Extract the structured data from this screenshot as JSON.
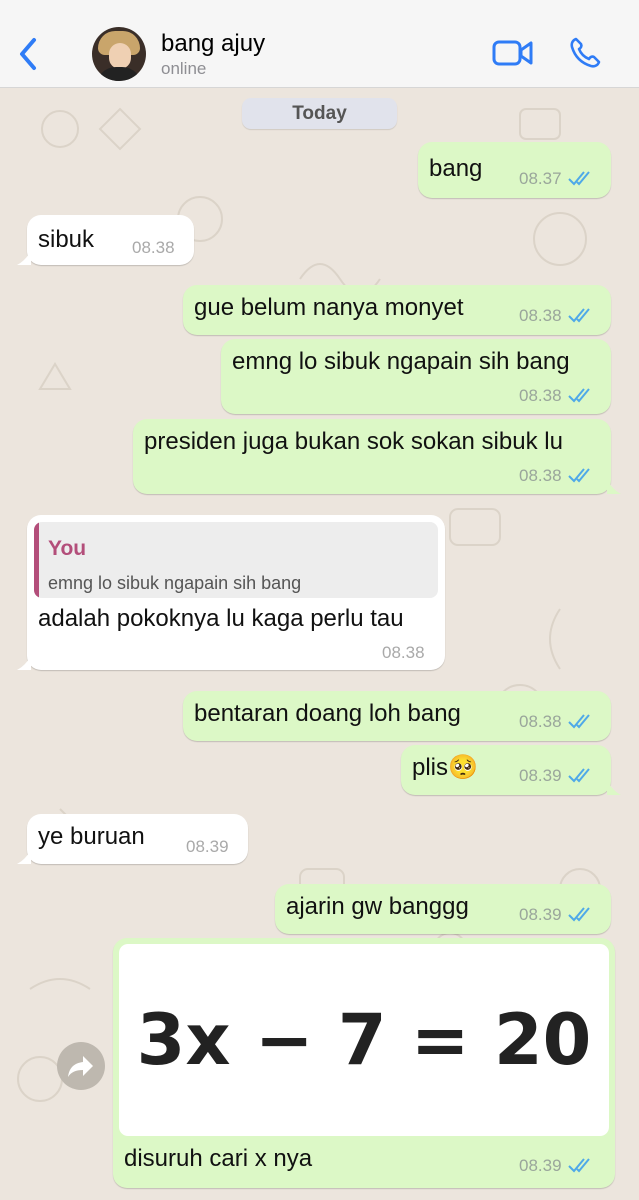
{
  "header": {
    "contact_name": "bang ajuy",
    "status": "online"
  },
  "date_chip": "Today",
  "messages": [
    {
      "dir": "out",
      "text": "bang",
      "time": "08.37",
      "read": true
    },
    {
      "dir": "in",
      "text": "sibuk",
      "time": "08.38"
    },
    {
      "dir": "out",
      "text": "gue belum nanya monyet",
      "time": "08.38",
      "read": true
    },
    {
      "dir": "out",
      "text": "emng lo sibuk ngapain sih bang",
      "time": "08.38",
      "read": true
    },
    {
      "dir": "out",
      "text": "presiden juga bukan sok sokan sibuk lu",
      "time": "08.38",
      "read": true
    },
    {
      "dir": "in",
      "quote_author": "You",
      "quote_text": "emng lo sibuk ngapain sih bang",
      "text": "adalah pokoknya lu kaga perlu tau",
      "time": "08.38"
    },
    {
      "dir": "out",
      "text": "bentaran doang loh bang",
      "time": "08.38",
      "read": true
    },
    {
      "dir": "out",
      "text": "plis🥺",
      "time": "08.39",
      "read": true
    },
    {
      "dir": "in",
      "text": "ye buruan",
      "time": "08.39"
    },
    {
      "dir": "out",
      "text": "ajarin gw banggg",
      "time": "08.39",
      "read": true
    },
    {
      "dir": "out",
      "image_text": "3x − 7 = 20",
      "text": "disuruh cari x nya",
      "time": "08.39",
      "read": true
    }
  ],
  "colors": {
    "outgoing_bubble": "#DCF8C6",
    "incoming_bubble": "#FFFFFF",
    "accent_blue": "#2F7CF6",
    "read_ticks": "#4FA9E8",
    "quote_author": "#B34E7A",
    "wallpaper": "#ECE5DD"
  },
  "icons": [
    "back-chevron-icon",
    "video-call-icon",
    "phone-call-icon",
    "read-ticks-icon",
    "forward-icon"
  ]
}
